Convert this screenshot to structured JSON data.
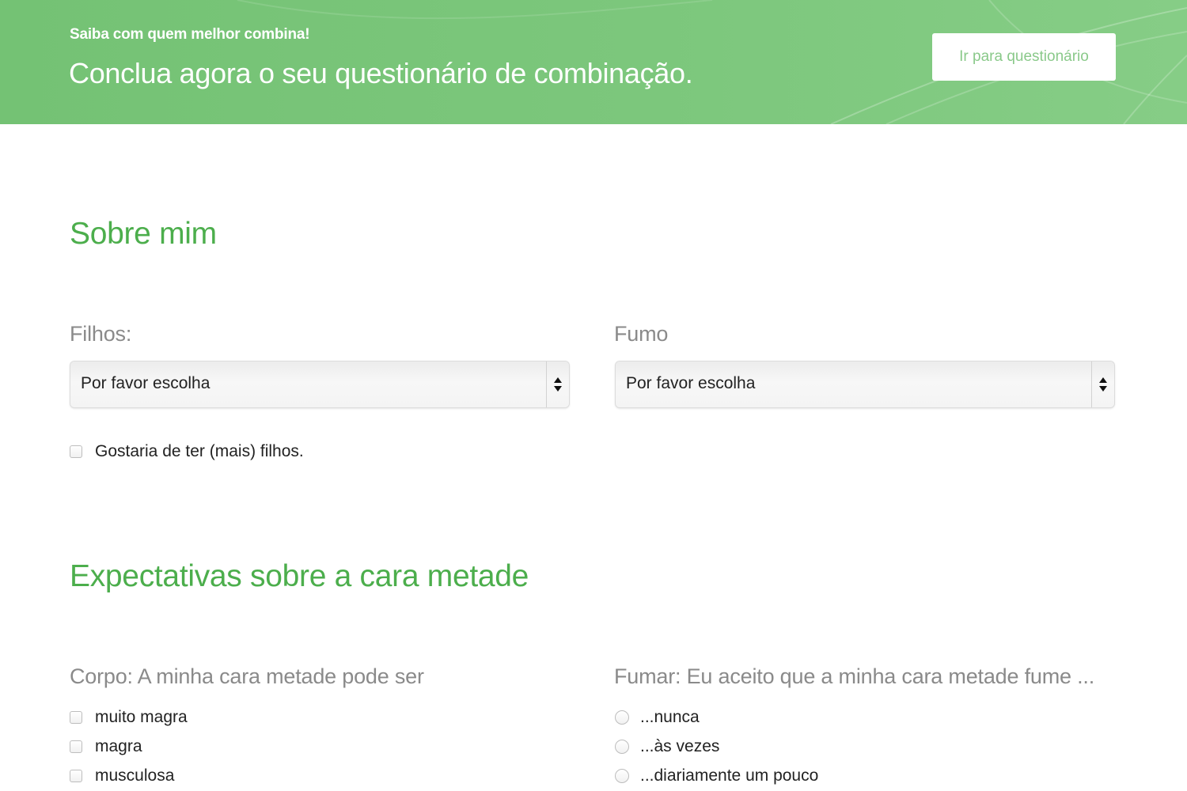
{
  "banner": {
    "kicker": "Saiba com quem melhor combina!",
    "title": "Conclua agora o seu questionário de combinação.",
    "button_label": "Ir para questionário"
  },
  "about": {
    "title": "Sobre mim",
    "children_label": "Filhos:",
    "children_value": "Por favor escolha",
    "smoke_label": "Fumo",
    "smoke_value": "Por favor escolha",
    "want_children_label": "Gostaria de ter (mais) filhos."
  },
  "expectations": {
    "title": "Expectativas sobre a cara metade",
    "body_label": "Corpo: A minha cara metade pode ser",
    "body_options": [
      "muito magra",
      "magra",
      "musculosa"
    ],
    "smoking_label": "Fumar: Eu aceito que a minha cara metade fume ...",
    "smoking_options": [
      "...nunca",
      "...às vezes",
      "...diariamente um pouco"
    ]
  },
  "colors": {
    "banner_green": "#7cc77c",
    "heading_green": "#4cae4c",
    "label_gray": "#8a8a8a"
  }
}
